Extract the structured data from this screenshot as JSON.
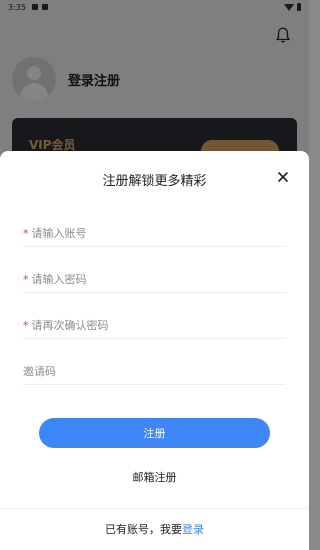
{
  "status_bar": {
    "time": "3:35"
  },
  "background": {
    "profile_name": "登录注册",
    "vip_title": "VIP会员"
  },
  "modal": {
    "title": "注册解锁更多精彩",
    "fields": {
      "account": {
        "placeholder": "请输入账号",
        "required_mark": "*"
      },
      "password": {
        "placeholder": "请输入密码",
        "required_mark": "*"
      },
      "confirm_password": {
        "placeholder": "请再次确认密码",
        "required_mark": "*"
      },
      "invite_code": {
        "placeholder": "邀请码"
      }
    },
    "register_label": "注册",
    "email_register_label": "邮箱注册",
    "footer": {
      "prompt": "已有账号，我要",
      "login_link": "登录"
    }
  },
  "colors": {
    "accent": "#3d86f5",
    "required": "#e53935",
    "vip_gold": "#e0b06b"
  }
}
